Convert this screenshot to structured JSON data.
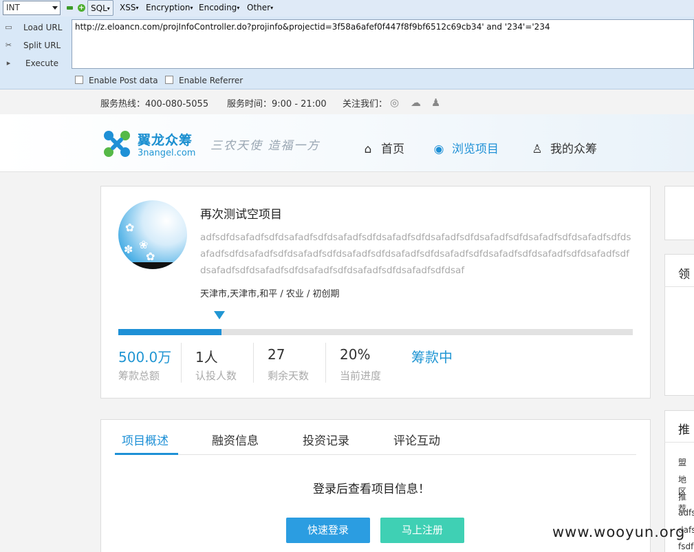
{
  "hackbar": {
    "select_value": "INT",
    "menus": [
      "SQL",
      "XSS",
      "Encryption",
      "Encoding",
      "Other"
    ],
    "side_buttons": [
      "Load URL",
      "Split URL",
      "Execute"
    ],
    "url": "http://z.eloancn.com/projInfoController.do?projinfo&projectid=3f58a6afef0f447f8f9bf6512c69cb34' and '234'='234",
    "checkboxes": [
      "Enable Post data",
      "Enable Referrer"
    ]
  },
  "infobar": {
    "hotline": "服务热线：400-080-5055",
    "hours": "服务时间：9:00 - 21:00",
    "follow": "关注我们："
  },
  "header": {
    "logo_cn": "翼龙众筹",
    "logo_en": "3nangel.com",
    "slogan": "三农天使  造福一方",
    "nav": [
      "首页",
      "浏览项目",
      "我的众筹"
    ]
  },
  "project": {
    "title": "再次测试空项目",
    "description": "adfsdfdsafadfsdfdsafadfsdfdsafadfsdfdsafadfsdfdsafadfsdfdsafadfsdfdsafadfsdfdsafadfsdfdsafadfsdfdsafadfsdfdsafadfsdfdsafadfsdfdsafadfsdfdsafadfsdfdsafadfsdfdsafadfsdfdsafadfsdfdsafadfsdfdsafadfsdfdsafadfsdfdsafadfsdfdsafadfsdfdsaf",
    "meta": "天津市,天津市,和平 /  农业  /  初创期",
    "progress_fraction": 0.2,
    "stats": [
      {
        "value": "500.0万",
        "label": "筹款总额"
      },
      {
        "value": "1人",
        "label": "认投人数"
      },
      {
        "value": "27",
        "label": "剩余天数"
      },
      {
        "value": "20%",
        "label": "当前进度"
      },
      {
        "value": "筹款中",
        "label": ""
      }
    ]
  },
  "tabs": [
    "项目概述",
    "融资信息",
    "投资记录",
    "评论互动"
  ],
  "content": {
    "login_message": "登录后查看项目信息！",
    "login_button": "快速登录",
    "register_button": "马上注册"
  },
  "sidebar": {
    "title1": "领",
    "title2": "推",
    "items": [
      "盟",
      "地区",
      "推荐",
      "adfs",
      "dafs",
      "fsdf"
    ]
  },
  "watermark": "www.wooyun.org",
  "colors": {
    "accent": "#1e90d6",
    "teal": "#3fd0b4",
    "hackbar": "#d9e8f7"
  }
}
